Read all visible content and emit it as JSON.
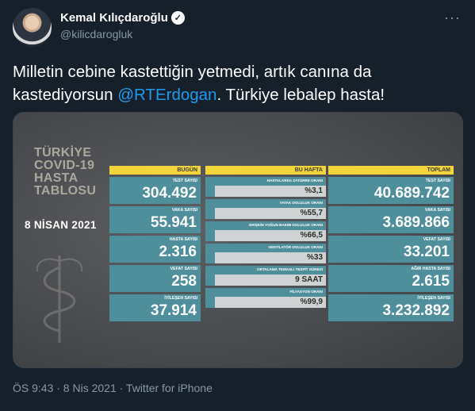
{
  "tweet": {
    "author_name": "Kemal Kılıçdaroğlu",
    "verified_icon": "verified-badge-icon",
    "handle": "@kilicdarogluk",
    "text_before": "Milletin cebine kastettiğin yetmedi, artık canına da kastediyorsun ",
    "mention": "@RTErdogan",
    "text_after": ". Türkiye lebalep hasta!",
    "more_label": "···",
    "footer": "ÖS 9:43 · 8 Nis 2021 · Twitter for iPhone"
  },
  "table": {
    "title_lines": [
      "TÜRKİYE",
      "COVID-19",
      "HASTA",
      "TABLOSU"
    ],
    "date": "8 NİSAN 2021",
    "today": {
      "header": "BUGÜN",
      "items": [
        {
          "label": "TEST SAYISI",
          "value": "304.492"
        },
        {
          "label": "VAKA SAYISI",
          "value": "55.941"
        },
        {
          "label": "HASTA SAYISI",
          "value": "2.316"
        },
        {
          "label": "VEFAT SAYISI",
          "value": "258"
        },
        {
          "label": "İYİLEŞEN SAYISI",
          "value": "37.914"
        }
      ]
    },
    "week": {
      "header": "BU HAFTA",
      "items": [
        {
          "label": "HASTALARDA ZATÜRRE ORANI",
          "value": "%3,1"
        },
        {
          "label": "YATAK DOLULUK ORANI",
          "value": "%55,7"
        },
        {
          "label": "ERİŞKİN YOĞUN BAKIM DOLULUK ORANI",
          "value": "%66,5"
        },
        {
          "label": "VENTİLATÖR DOLULUK ORANI",
          "value": "%33"
        },
        {
          "label": "ORTALAMA TEMASLI TESPİT SÜRESİ",
          "value": "9 SAAT"
        },
        {
          "label": "FİLYASYON ORANI",
          "value": "%99,9"
        }
      ]
    },
    "total": {
      "header": "TOPLAM",
      "items": [
        {
          "label": "TEST SAYISI",
          "value": "40.689.742"
        },
        {
          "label": "VAKA SAYISI",
          "value": "3.689.866"
        },
        {
          "label": "VEFAT SAYISI",
          "value": "33.201"
        },
        {
          "label": "AĞIR HASTA SAYISI",
          "value": "2.615"
        },
        {
          "label": "İYİLEŞEN SAYISI",
          "value": "3.232.892"
        }
      ]
    }
  }
}
